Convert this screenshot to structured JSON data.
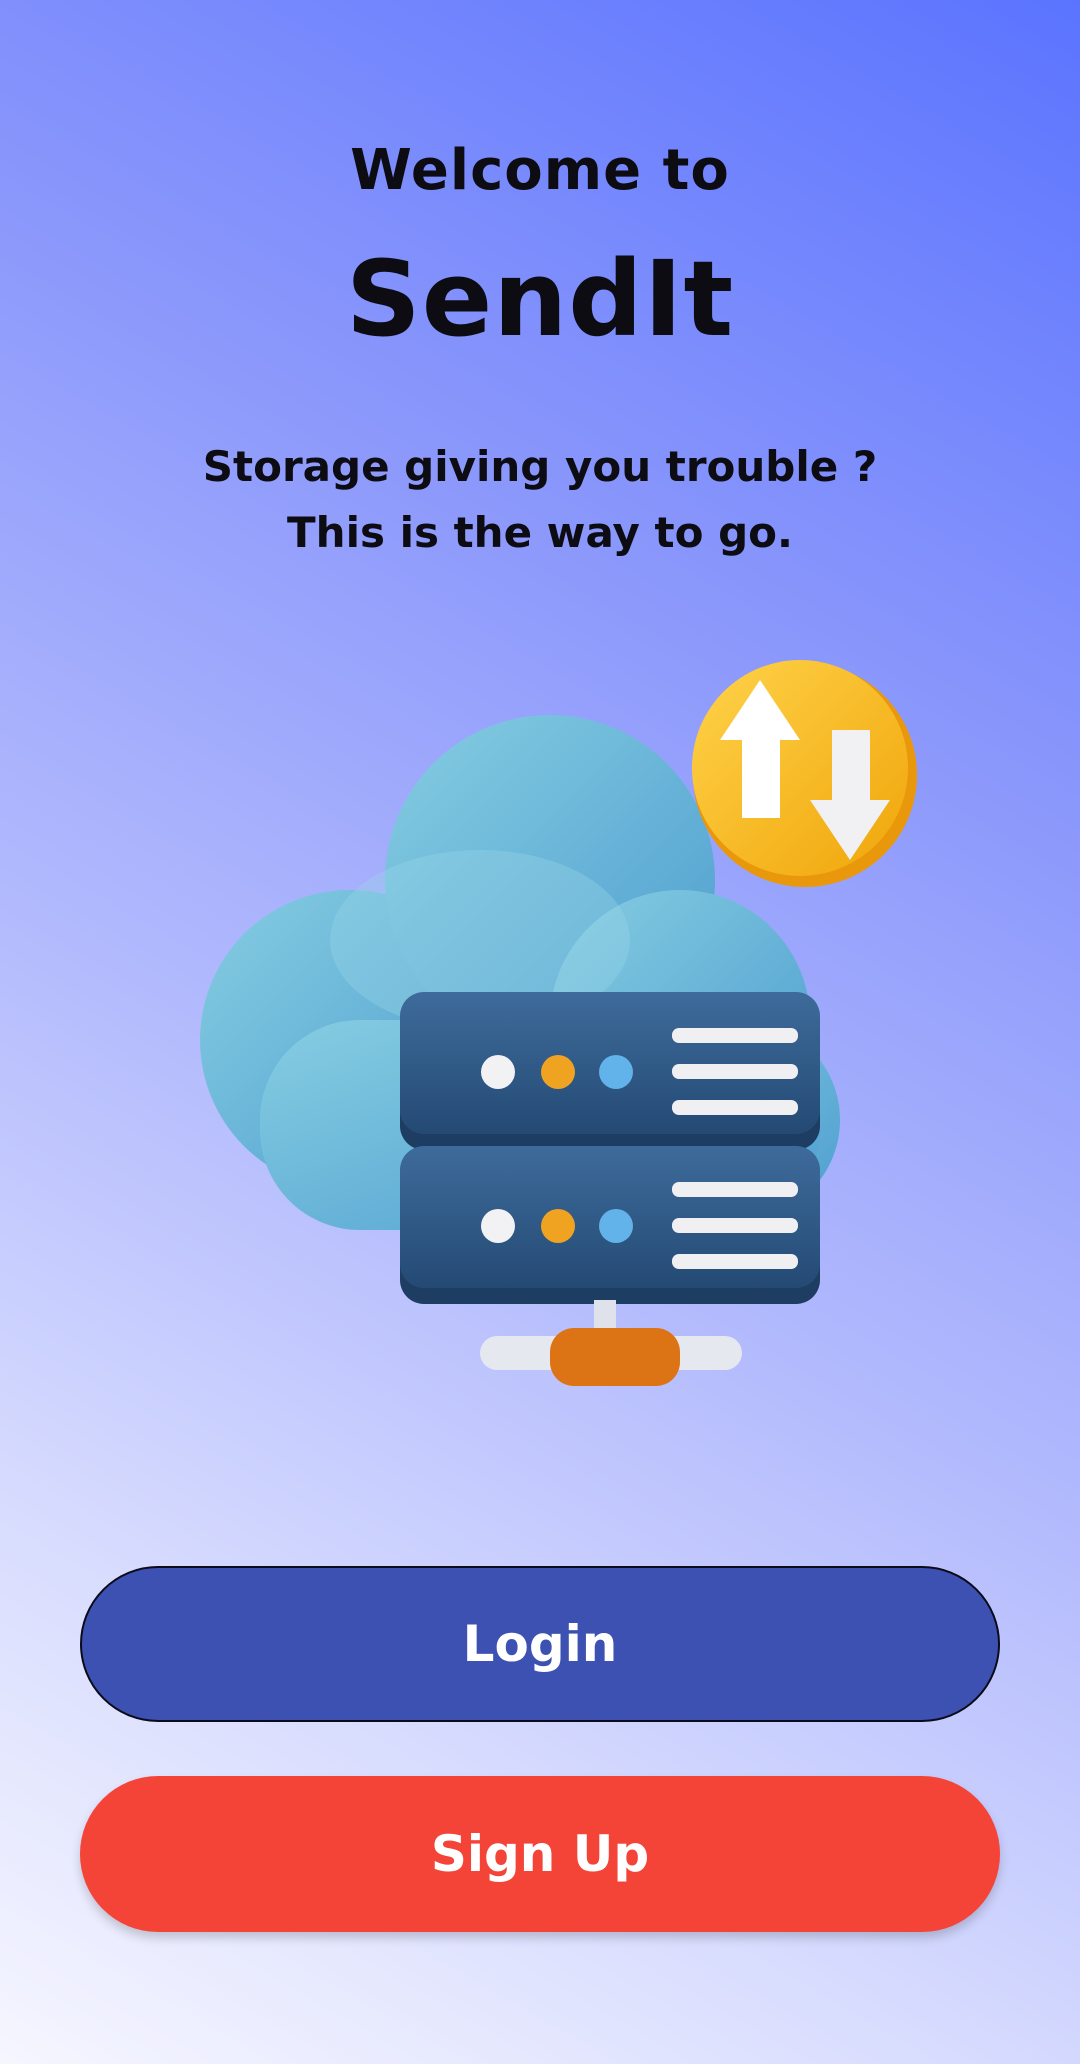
{
  "header": {
    "welcome": "Welcome to",
    "app_name": "SendIt"
  },
  "tagline": {
    "line1": "Storage giving you trouble ?",
    "line2": "This is the way to go."
  },
  "illustration": {
    "icon": "cloud-server-upload-download-icon"
  },
  "actions": {
    "login_label": "Login",
    "signup_label": "Sign Up"
  },
  "colors": {
    "login_bg": "#3d51b3",
    "signup_bg": "#f34437",
    "gradient_top": "#5b74ff",
    "gradient_bottom": "#f6f6ff"
  }
}
